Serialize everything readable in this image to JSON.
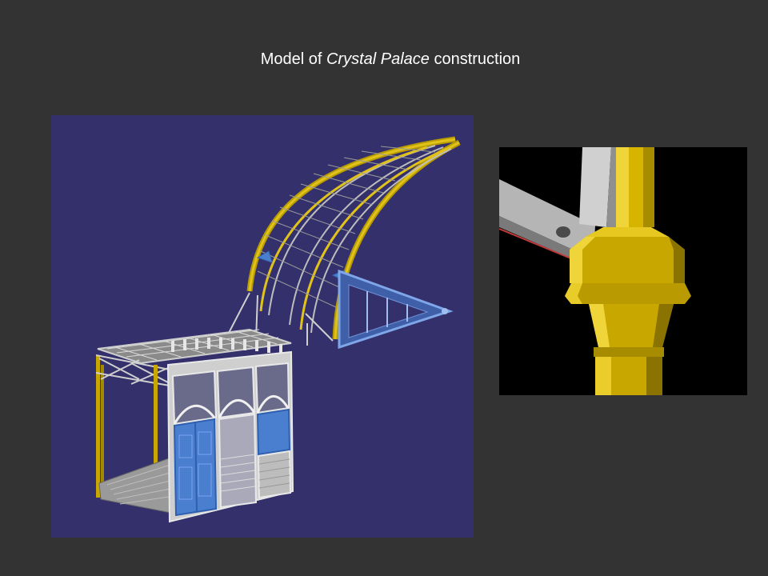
{
  "slide": {
    "title_prefix": "Model of ",
    "title_italic": "Crystal Palace",
    "title_suffix": " construction"
  },
  "colors": {
    "slide_background": "#333333",
    "title_text": "#ffffff",
    "render_background": "#34306b",
    "detail_background": "#000000",
    "cast_iron_yellow": "#c8a800",
    "panel_blue": "#4a7fd0",
    "frame_grey": "#c9c9c9"
  },
  "figures": {
    "model_render": "3d-render-arched-transept-section",
    "detail_render": "3d-render-column-capital-detail"
  }
}
